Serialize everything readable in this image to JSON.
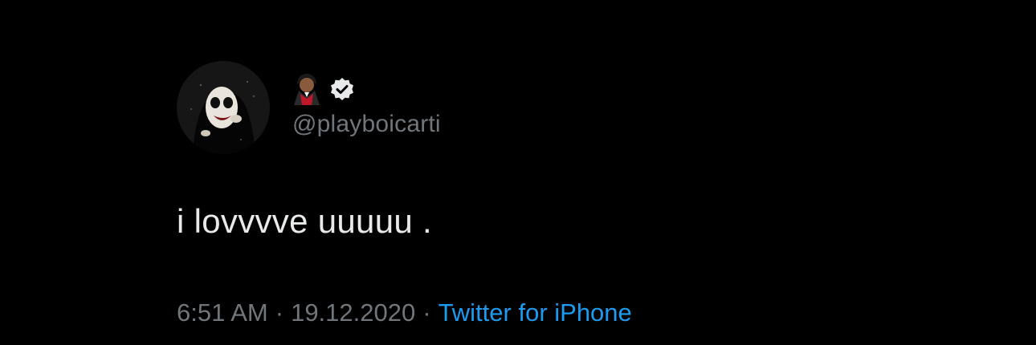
{
  "tweet": {
    "author": {
      "handle": "@playboicarti",
      "emoji_icon": "vampire-emoji",
      "verified": true,
      "avatar_icon": "profile-avatar"
    },
    "text": "i lovvvve uuuuu .",
    "timestamp": {
      "time": "6:51 AM",
      "separator": "·",
      "date": "19.12.2020",
      "source": "Twitter for iPhone"
    }
  },
  "colors": {
    "background": "#000000",
    "primary_text": "#e7e9ea",
    "secondary_text": "#71767b",
    "link": "#1d9bf0"
  }
}
